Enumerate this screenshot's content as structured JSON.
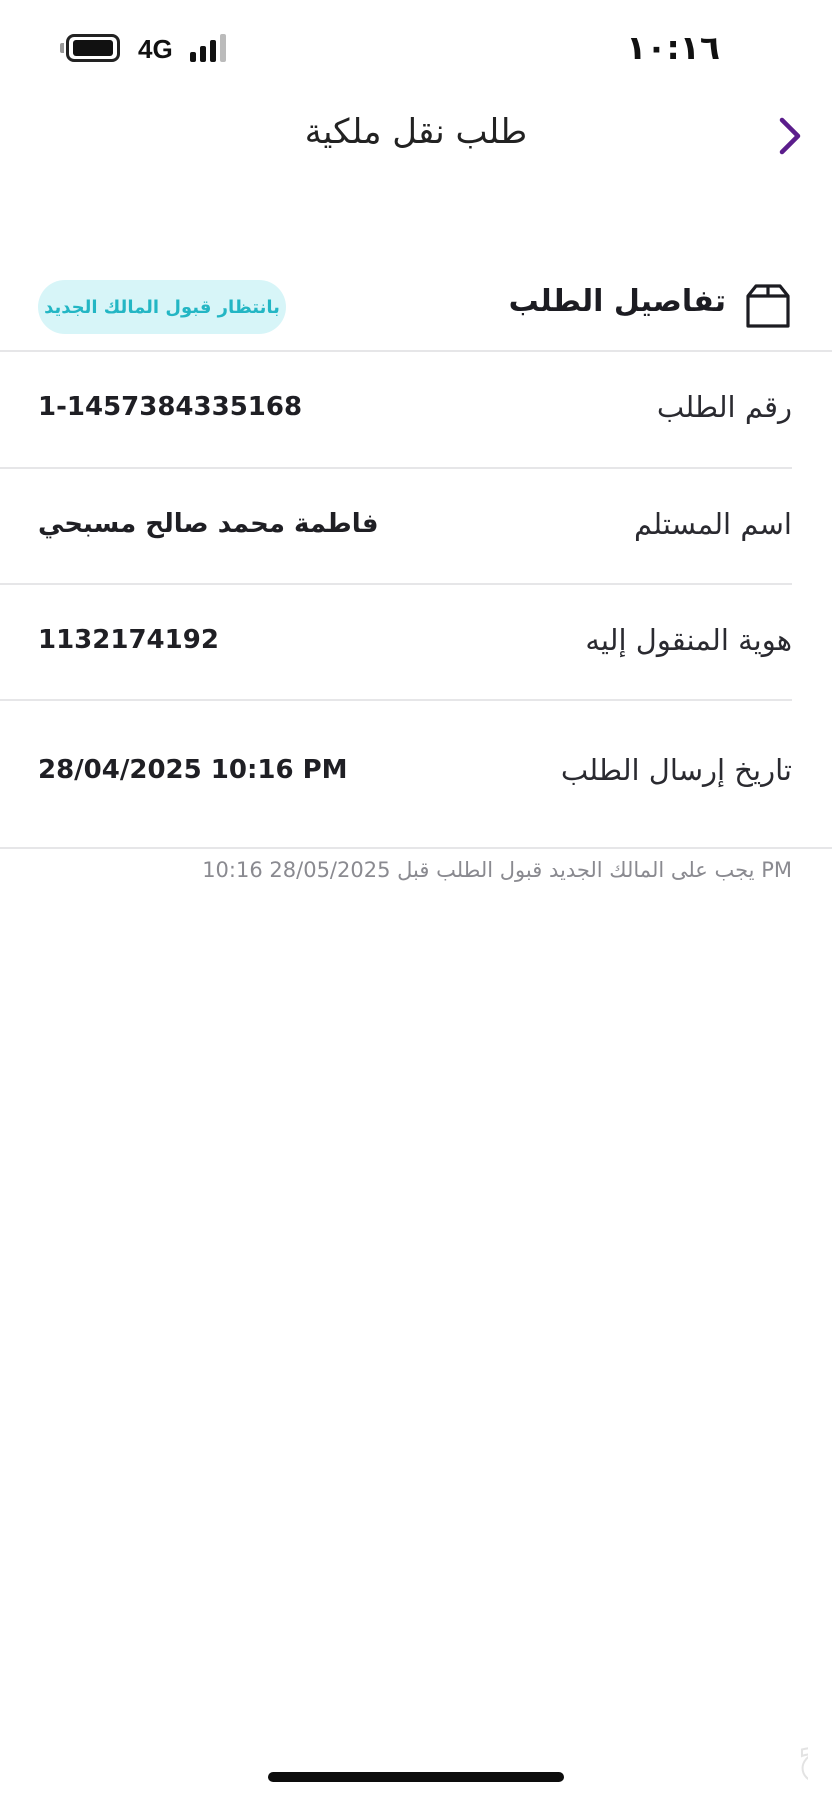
{
  "status_bar": {
    "time": "١٠:١٦",
    "network": "4G",
    "battery_icon": "battery-icon",
    "signal_icon": "signal-icon"
  },
  "nav": {
    "title": "طلب نقل ملكية",
    "back_icon": "chevron-right-icon"
  },
  "section": {
    "title": "تفاصيل الطلب",
    "icon": "box-icon",
    "status_badge": "بانتظار قبول المالك الجديد",
    "badge_bg": "#d7f5f8",
    "badge_text_color": "#23b6c4"
  },
  "details": [
    {
      "label": "رقم الطلب",
      "value": "1-1457384335168"
    },
    {
      "label": "اسم المستلم",
      "value": "فاطمة محمد صالح مسبحي"
    },
    {
      "label": "هوية المنقول إليه",
      "value": "1132174192"
    },
    {
      "label": "تاريخ إرسال الطلب",
      "value": "28/04/2025 10:16 PM"
    }
  ],
  "footnote": "يجب على المالك الجديد قبول الطلب قبل 28/05/2025 10:16 PM",
  "accent_color": "#5b1d8c",
  "watermark_text": "حراج"
}
